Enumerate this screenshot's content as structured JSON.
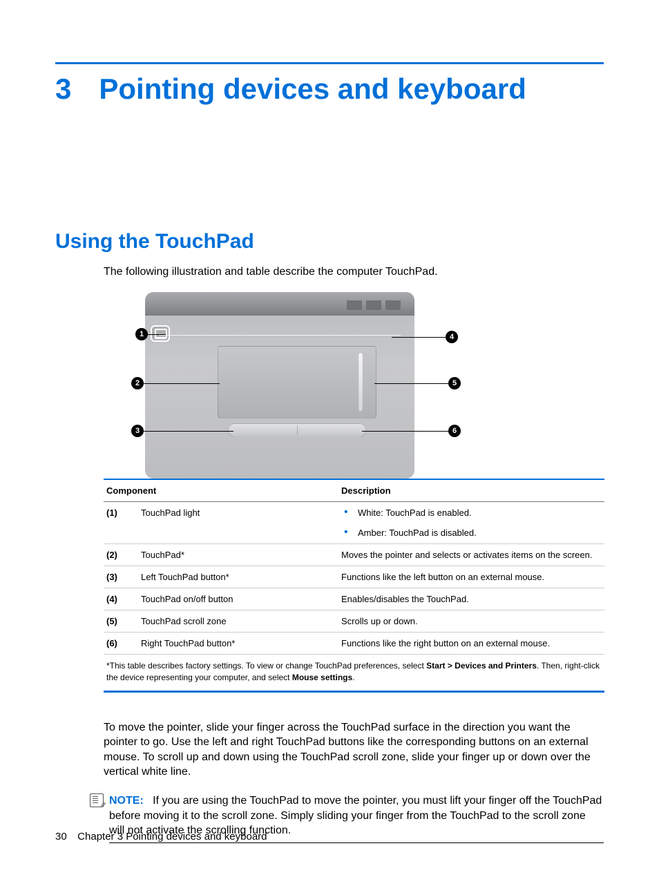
{
  "chapter": {
    "number": "3",
    "title": "Pointing devices and keyboard"
  },
  "section": {
    "heading": "Using the TouchPad",
    "intro": "The following illustration and table describe the computer TouchPad."
  },
  "callouts": [
    "1",
    "2",
    "3",
    "4",
    "5",
    "6"
  ],
  "table": {
    "headers": {
      "component": "Component",
      "description": "Description"
    },
    "rows": [
      {
        "num": "(1)",
        "name": "TouchPad light",
        "desc_type": "bullets",
        "bullets": [
          "White: TouchPad is enabled.",
          "Amber: TouchPad is disabled."
        ]
      },
      {
        "num": "(2)",
        "name": "TouchPad*",
        "desc_type": "text",
        "desc": "Moves the pointer and selects or activates items on the screen."
      },
      {
        "num": "(3)",
        "name": "Left TouchPad button*",
        "desc_type": "text",
        "desc": "Functions like the left button on an external mouse."
      },
      {
        "num": "(4)",
        "name": "TouchPad on/off button",
        "desc_type": "text",
        "desc": "Enables/disables the TouchPad."
      },
      {
        "num": "(5)",
        "name": "TouchPad scroll zone",
        "desc_type": "text",
        "desc": "Scrolls up or down."
      },
      {
        "num": "(6)",
        "name": "Right TouchPad button*",
        "desc_type": "text",
        "desc": "Functions like the right button on an external mouse."
      }
    ],
    "footnote": {
      "pre": "*This table describes factory settings. To view or change TouchPad preferences, select ",
      "bold1": "Start > Devices and Printers",
      "mid": ". Then, right-click the device representing your computer, and select ",
      "bold2": "Mouse settings",
      "post": "."
    }
  },
  "body_para": "To move the pointer, slide your finger across the TouchPad surface in the direction you want the pointer to go. Use the left and right TouchPad buttons like the corresponding buttons on an external mouse. To scroll up and down using the TouchPad scroll zone, slide your finger up or down over the vertical white line.",
  "note": {
    "label": "NOTE:",
    "text": "If you are using the TouchPad to move the pointer, you must lift your finger off the TouchPad before moving it to the scroll zone. Simply sliding your finger from the TouchPad to the scroll zone will not activate the scrolling function."
  },
  "footer": {
    "page": "30",
    "chapter_label": "Chapter 3   Pointing devices and keyboard"
  }
}
